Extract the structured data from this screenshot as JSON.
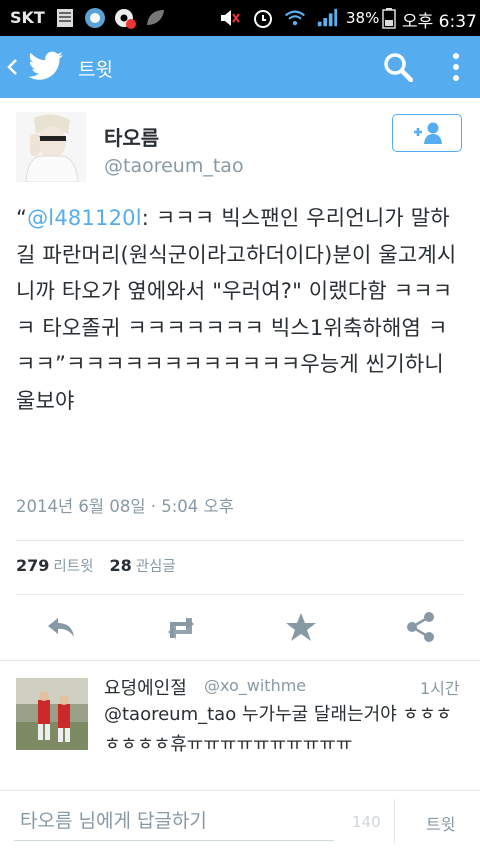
{
  "status_bar": {
    "carrier": "SKT",
    "battery_percent": "38%",
    "clock": "오후 6:37"
  },
  "app_bar": {
    "title": "트윗",
    "back_icon": "back-chevron-icon",
    "logo_icon": "twitter-bird-icon",
    "search_icon": "search-icon",
    "overflow_icon": "overflow-menu-icon"
  },
  "tweet": {
    "author_name": "타오름",
    "author_handle": "@taoreum_tao",
    "text_prefix": "“",
    "mention": "@l481120l",
    "text_body": ": ㅋㅋㅋ 빅스팬인 우리언니가 말하길 파란머리(원식군이라고하더이다)분이 울고계시니까 타오가 옆에와서 \"우러여?\" 이랬다함 ㅋㅋㅋㅋ 타오졸귀 ㅋㅋㅋㅋㅋㅋㅋ 빅스1위축하해염 ㅋㅋㅋ”ㅋㅋㅋㅋㅋㅋㅋㅋㅋㅋㅋㅋ우능게 씬기하니 울보야",
    "timestamp": "2014년 6월 08일 · 5:04 오후",
    "retweet_count": "279",
    "retweet_label": "리트윗",
    "favorite_count": "28",
    "favorite_label": "관심글"
  },
  "reply": {
    "name": "요뎡에인절",
    "handle": "@xo_withme",
    "time": "1시간",
    "text": "@taoreum_tao 누가누굴 달래는거야 ㅎㅎㅎㅎㅎㅎㅎ휴ㅠㅠㅠㅠㅠㅠㅠㅠㅠㅠ"
  },
  "composer": {
    "placeholder": "타오름 님에게 답글하기",
    "char_count": "140",
    "send_label": "트윗"
  },
  "colors": {
    "accent": "#55acee",
    "text": "#292f33",
    "muted": "#8899a6"
  }
}
